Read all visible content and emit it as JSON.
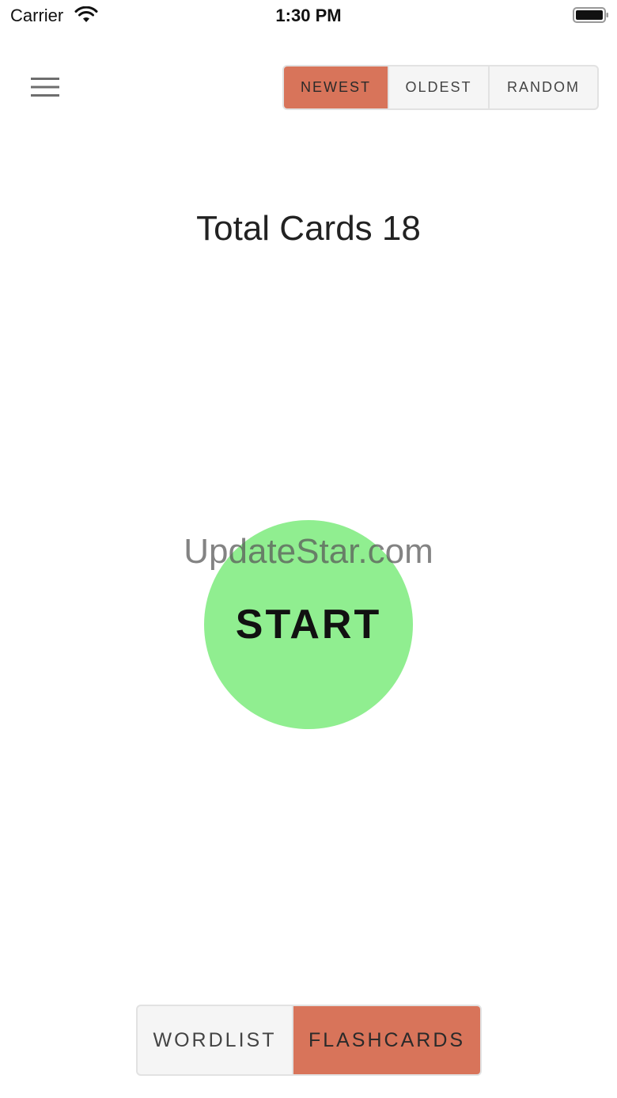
{
  "status_bar": {
    "carrier": "Carrier",
    "time": "1:30 PM",
    "wifi_icon": "wifi-icon",
    "battery_icon": "battery-icon"
  },
  "header": {
    "menu_icon": "hamburger-menu-icon",
    "sort_options": [
      {
        "label": "NEWEST",
        "active": true
      },
      {
        "label": "OLDEST",
        "active": false
      },
      {
        "label": "RANDOM",
        "active": false
      }
    ]
  },
  "main": {
    "total_text": "Total Cards 18",
    "start_label": "START",
    "watermark": "UpdateStar.com"
  },
  "footer": {
    "views": [
      {
        "label": "WORDLIST",
        "active": false
      },
      {
        "label": "FLASHCARDS",
        "active": true
      }
    ]
  },
  "colors": {
    "accent": "#d8745a",
    "start_green": "#90ee90",
    "segment_bg": "#f5f5f5",
    "border": "#e2e2e2"
  }
}
